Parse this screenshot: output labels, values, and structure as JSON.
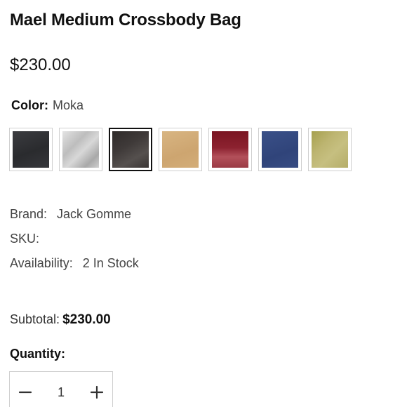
{
  "product": {
    "title": "Mael Medium Crossbody Bag",
    "price": "$230.00"
  },
  "color": {
    "label": "Color:",
    "selected": "Moka",
    "swatches": [
      {
        "name": "black",
        "fill": "#2f3033",
        "selected": false
      },
      {
        "name": "light-grey",
        "fill": "#c9c9c9",
        "selected": false
      },
      {
        "name": "moka",
        "fill": "#3a3534",
        "selected": true
      },
      {
        "name": "tan",
        "fill": "#d1ad78",
        "selected": false
      },
      {
        "name": "burgundy",
        "fill": "#8c2230",
        "selected": false
      },
      {
        "name": "navy",
        "fill": "#34497e",
        "selected": false
      },
      {
        "name": "olive",
        "fill": "#b8b06a",
        "selected": false
      }
    ]
  },
  "details": {
    "brand_label": "Brand:",
    "brand_value": "Jack Gomme",
    "sku_label": "SKU:",
    "sku_value": "",
    "availability_label": "Availability:",
    "availability_value": "2 In Stock"
  },
  "subtotal": {
    "label": "Subtotal:",
    "amount": "$230.00"
  },
  "quantity": {
    "label": "Quantity:",
    "value": "1",
    "decrement_icon": "minus-icon",
    "increment_icon": "plus-icon"
  }
}
